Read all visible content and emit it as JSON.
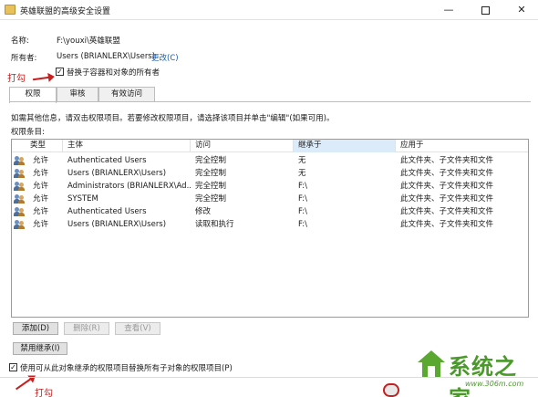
{
  "window": {
    "title": "英雄联盟的高级安全设置",
    "minimize_glyph": "—",
    "close_glyph": "✕"
  },
  "info": {
    "name_label": "名称:",
    "name_value": "F:\\youxi\\英雄联盟",
    "owner_label": "所有者:",
    "owner_value": "Users (BRIANLERX\\Users)",
    "change_link": "更改(C)",
    "replace_owner_checkbox": {
      "label": "替换子容器和对象的所有者",
      "checked": true
    }
  },
  "annotations": {
    "top": "打勾",
    "bottom": "打勾"
  },
  "tabs": [
    {
      "label": "权限",
      "active": true
    },
    {
      "label": "审核",
      "active": false
    },
    {
      "label": "有效访问",
      "active": false
    }
  ],
  "instructions": "如需其他信息，请双击权限项目。若要修改权限项目，请选择该项目并单击\"编辑\"(如果可用)。",
  "entries_label": "权限条目:",
  "permissions": {
    "columns": [
      "类型",
      "主体",
      "访问",
      "继承于",
      "应用于"
    ],
    "sorted_column": "继承于",
    "rows": [
      {
        "type": "允许",
        "principal": "Authenticated Users",
        "access": "完全控制",
        "inherited": "无",
        "applies": "此文件夹、子文件夹和文件"
      },
      {
        "type": "允许",
        "principal": "Users (BRIANLERX\\Users)",
        "access": "完全控制",
        "inherited": "无",
        "applies": "此文件夹、子文件夹和文件"
      },
      {
        "type": "允许",
        "principal": "Administrators (BRIANLERX\\Ad...",
        "access": "完全控制",
        "inherited": "F:\\",
        "applies": "此文件夹、子文件夹和文件"
      },
      {
        "type": "允许",
        "principal": "SYSTEM",
        "access": "完全控制",
        "inherited": "F:\\",
        "applies": "此文件夹、子文件夹和文件"
      },
      {
        "type": "允许",
        "principal": "Authenticated Users",
        "access": "修改",
        "inherited": "F:\\",
        "applies": "此文件夹、子文件夹和文件"
      },
      {
        "type": "允许",
        "principal": "Users (BRIANLERX\\Users)",
        "access": "读取和执行",
        "inherited": "F:\\",
        "applies": "此文件夹、子文件夹和文件"
      }
    ]
  },
  "buttons": {
    "add": "添加(D)",
    "remove": "删除(R)",
    "view": "查看(V)",
    "disable_inheritance": "禁用继承(I)"
  },
  "replace_child_checkbox": {
    "label": "使用可从此对象继承的权限项目替换所有子对象的权限项目(P)",
    "checked": true
  },
  "watermark": {
    "brand": "系统之家",
    "url": "www.306m.com"
  },
  "colors": {
    "link": "#1a5fb4",
    "annotation": "#c81e1e",
    "sorted_header": "#dcebfa"
  }
}
